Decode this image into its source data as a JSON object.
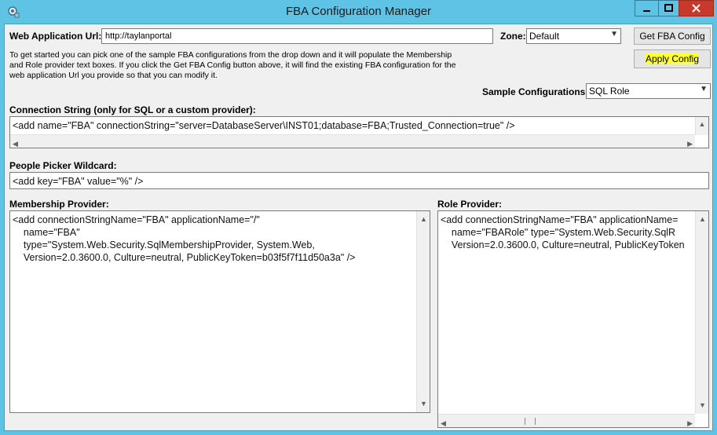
{
  "window": {
    "title": "FBA Configuration Manager"
  },
  "web_app": {
    "label": "Web Application Url:",
    "value": "http://taylanportal"
  },
  "zone": {
    "label": "Zone:",
    "value": "Default"
  },
  "buttons": {
    "get_config": "Get FBA Config",
    "apply_config": "Apply Config"
  },
  "info_text": [
    "To get started you can pick one of the sample FBA configurations from the drop down and it will populate the Membership",
    "and Role provider text boxes.  If you click the Get FBA Config button above, it will find the existing FBA configuration for the",
    "web application Url you provide so that you can modify it."
  ],
  "sample_configs": {
    "label": "Sample Configurations:",
    "value": "SQL Role"
  },
  "connection_string": {
    "label": "Connection String (only for SQL or a custom provider):",
    "value": "<add name=\"FBA\" connectionString=\"server=DatabaseServer\\INST01;database=FBA;Trusted_Connection=true\" />"
  },
  "people_picker": {
    "label": "People Picker Wildcard:",
    "value": "<add key=\"FBA\" value=\"%\" />"
  },
  "membership_provider": {
    "label": "Membership Provider:",
    "lines": [
      "<add connectionStringName=\"FBA\" applicationName=\"/\"",
      "    name=\"FBA\"",
      "    type=\"System.Web.Security.SqlMembershipProvider, System.Web,",
      "    Version=2.0.3600.0, Culture=neutral, PublicKeyToken=b03f5f7f11d50a3a\" />"
    ]
  },
  "role_provider": {
    "label": "Role Provider:",
    "lines": [
      "<add connectionStringName=\"FBA\" applicationName=",
      "    name=\"FBARole\" type=\"System.Web.Security.SqlR",
      "    Version=2.0.3600.0, Culture=neutral, PublicKeyToken"
    ]
  }
}
